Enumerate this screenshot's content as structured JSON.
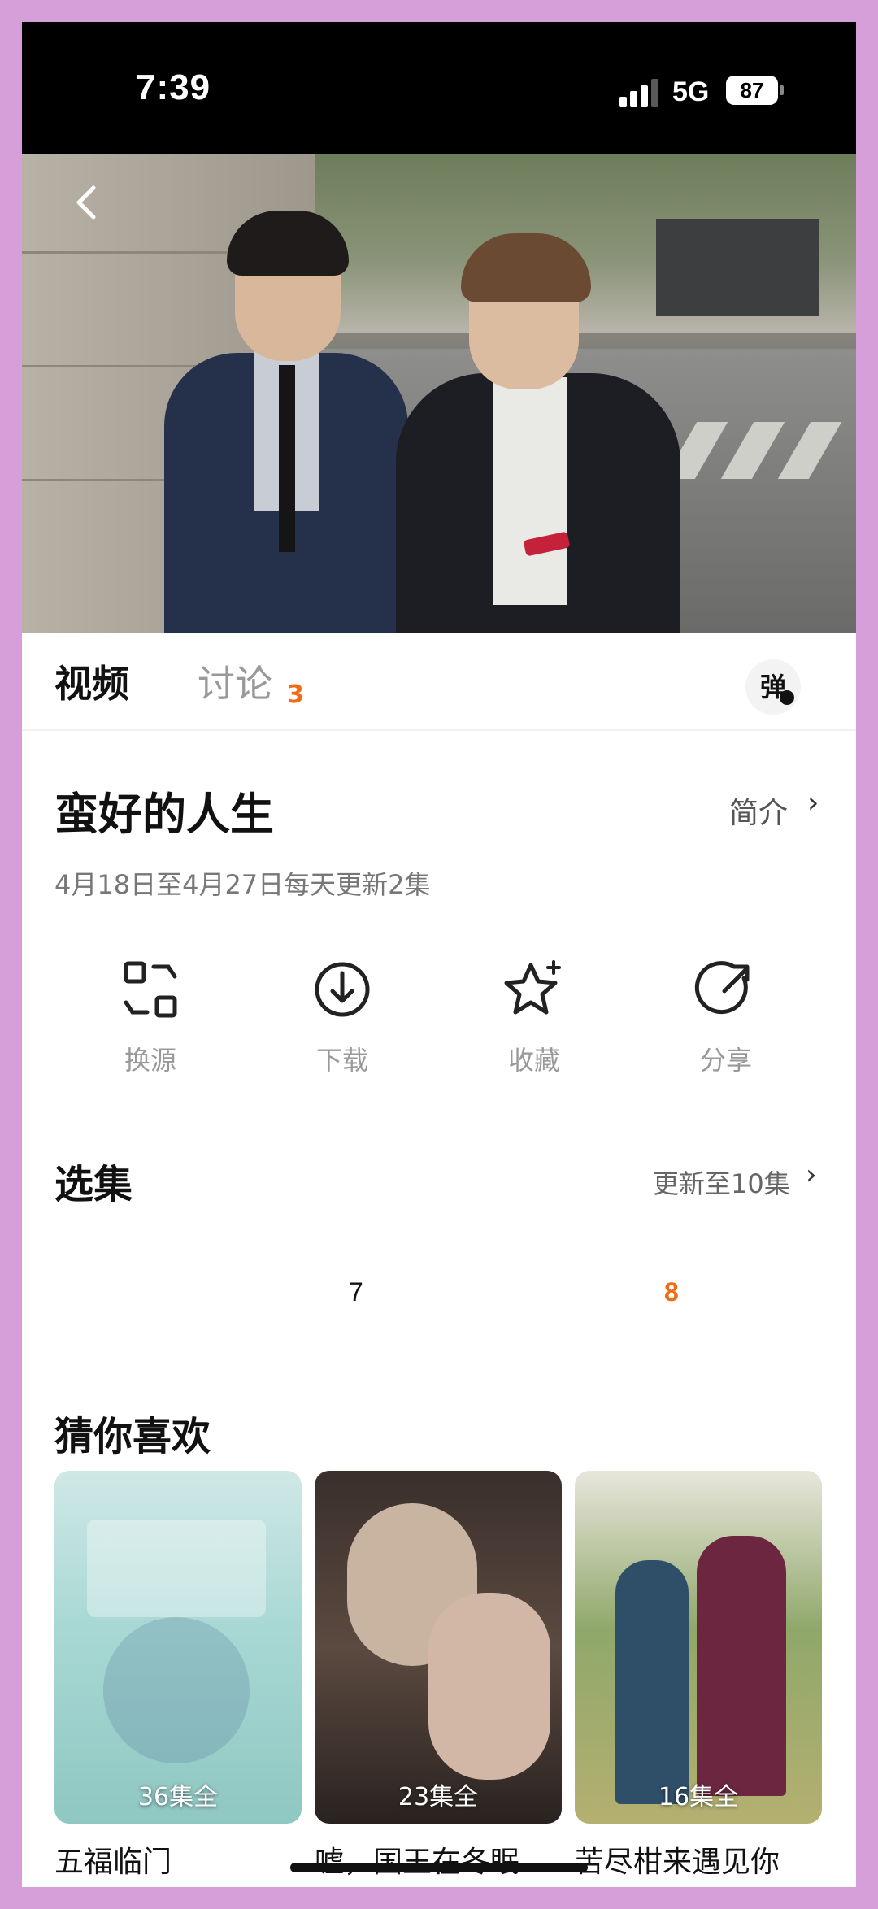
{
  "status_bar": {
    "time": "7:39",
    "network": "5G",
    "battery": "87"
  },
  "tabs": {
    "video": "视频",
    "discuss": "讨论",
    "discuss_count": "3",
    "danmaku": "弹"
  },
  "show": {
    "title": "蛮好的人生",
    "intro": "简介",
    "update_info": "4月18日至4月27日每天更新2集"
  },
  "actions": [
    {
      "label": "换源",
      "icon": "switch-source-icon"
    },
    {
      "label": "下载",
      "icon": "download-icon"
    },
    {
      "label": "收藏",
      "icon": "favorite-star-icon"
    },
    {
      "label": "分享",
      "icon": "share-icon"
    }
  ],
  "episodes": {
    "title": "选集",
    "more": "更新至10集",
    "visible": [
      "7",
      "8"
    ],
    "active": "8"
  },
  "recommendations": {
    "title": "猜你喜欢",
    "items": [
      {
        "name": "五福临门",
        "episodes": "36集全"
      },
      {
        "name": "嘘，国王在冬眠",
        "episodes": "23集全"
      },
      {
        "name": "苦尽柑来遇见你",
        "episodes": "16集全"
      }
    ]
  },
  "colors": {
    "accent": "#f26a13",
    "frame": "#d79fd9"
  }
}
